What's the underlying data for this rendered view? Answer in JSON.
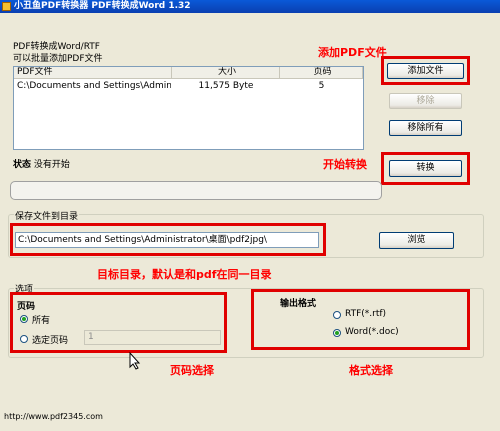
{
  "window": {
    "title": "小丑鱼PDF转换器  PDF转换成Word 1.32"
  },
  "panel": {
    "heading": "PDF转换成Word/RTF",
    "subheading": "可以批量添加PDF文件"
  },
  "file_list": {
    "columns": [
      "PDF文件",
      "大小",
      "页码"
    ],
    "rows": [
      {
        "file": "C:\\Documents and Settings\\Administrat...",
        "size": "11,575 Byte",
        "pages": "5"
      }
    ]
  },
  "buttons": {
    "add_file": "添加文件",
    "remove": "移除",
    "remove_all": "移除所有",
    "convert": "转换",
    "browse": "浏览"
  },
  "status": {
    "label": "状态",
    "value": "没有开始"
  },
  "progress": {
    "fraction": 0
  },
  "save_dir": {
    "group_label": "保存文件到目录",
    "path": "C:\\Documents and Settings\\Administrator\\桌面\\pdf2jpg\\"
  },
  "options": {
    "group_label": "选项",
    "pages_label": "页码",
    "all_pages": "所有",
    "select_pages": "选定页码",
    "page_input_value": "1",
    "format_label": "输出格式",
    "format_rtf": "RTF(*.rtf)",
    "format_doc": "Word(*.doc)"
  },
  "annotations": {
    "add_pdf": "添加PDF文件",
    "start_convert": "开始转换",
    "target_dir": "目标目录，默认是和pdf在同一目录",
    "page_select": "页码选择",
    "format_select": "格式选择"
  },
  "footer": {
    "url": "http://www.pdf2345.com"
  },
  "colors": {
    "annotation_red": "#E00000",
    "titlebar_blue": "#0A59D8",
    "dialog_bg": "#ECE9D8"
  }
}
